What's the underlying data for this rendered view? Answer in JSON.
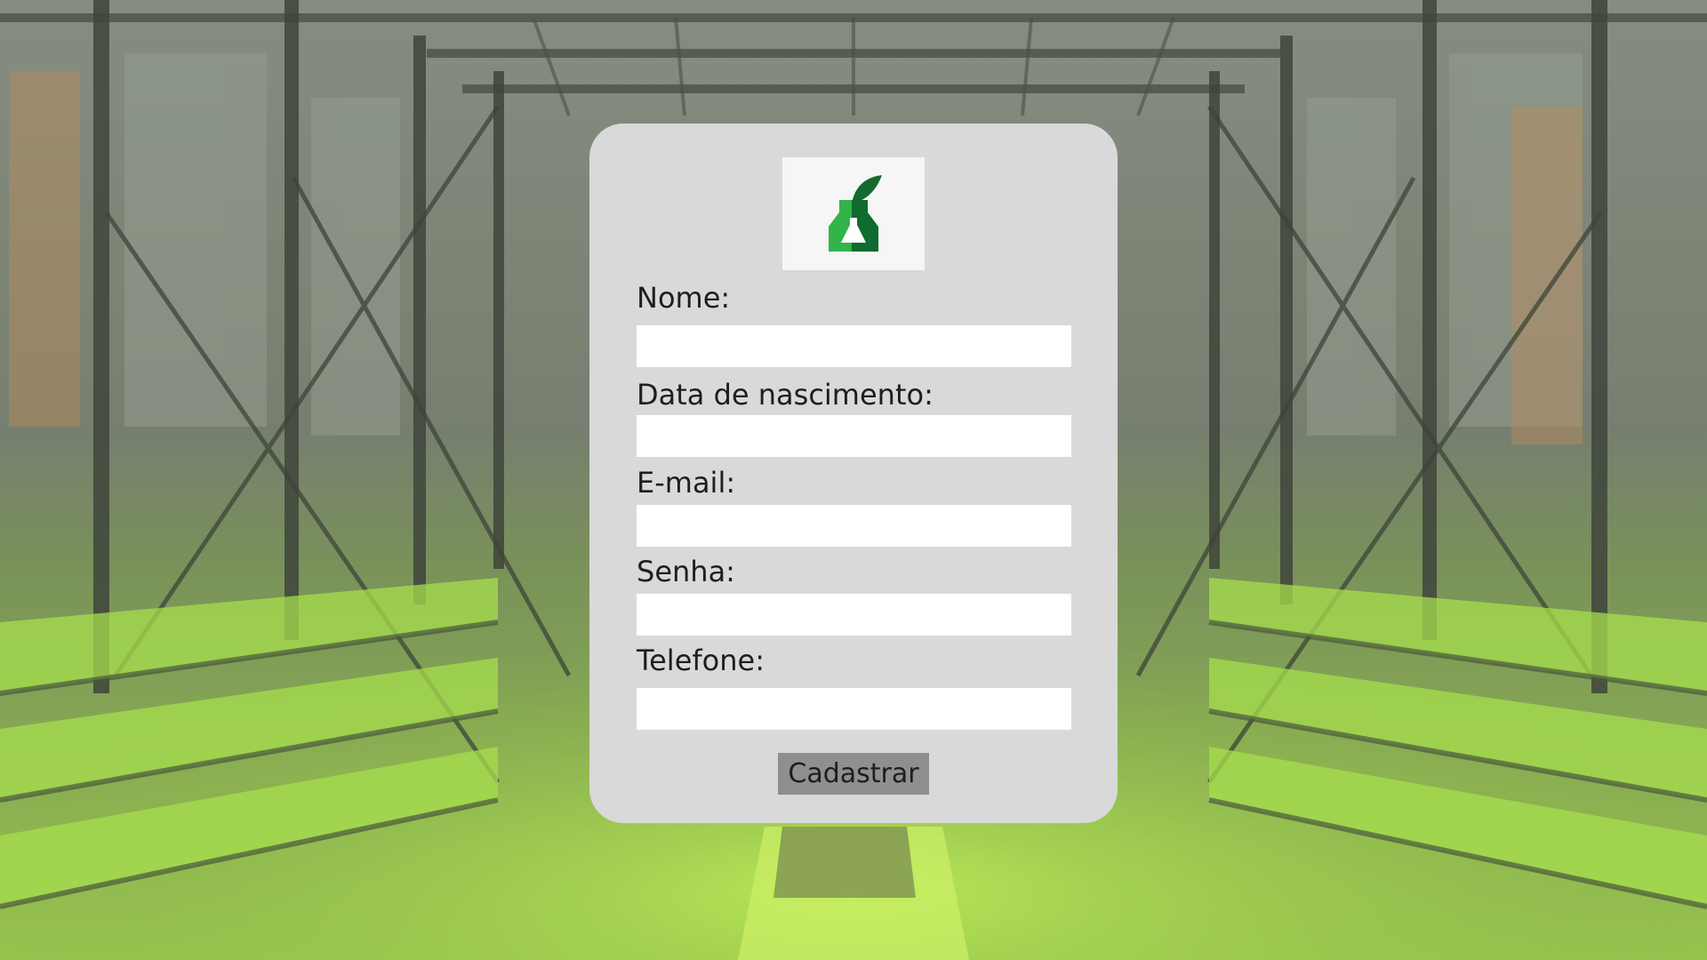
{
  "background": {
    "description_icon": "greenhouse-background-image",
    "accent": "#8bd13a"
  },
  "logo": {
    "icon": "flask-leaf-logo-icon",
    "colors": {
      "dark": "#0f6b2f",
      "light": "#33b44a",
      "leaf": "#14692e"
    }
  },
  "form": {
    "fields": [
      {
        "label": "Nome:",
        "value": "",
        "type": "text"
      },
      {
        "label": "Data de nascimento:",
        "value": "",
        "type": "text"
      },
      {
        "label": "E-mail:",
        "value": "",
        "type": "email"
      },
      {
        "label": "Senha:",
        "value": "",
        "type": "password"
      },
      {
        "label": "Telefone:",
        "value": "",
        "type": "tel"
      }
    ],
    "submit_label": "Cadastrar"
  }
}
